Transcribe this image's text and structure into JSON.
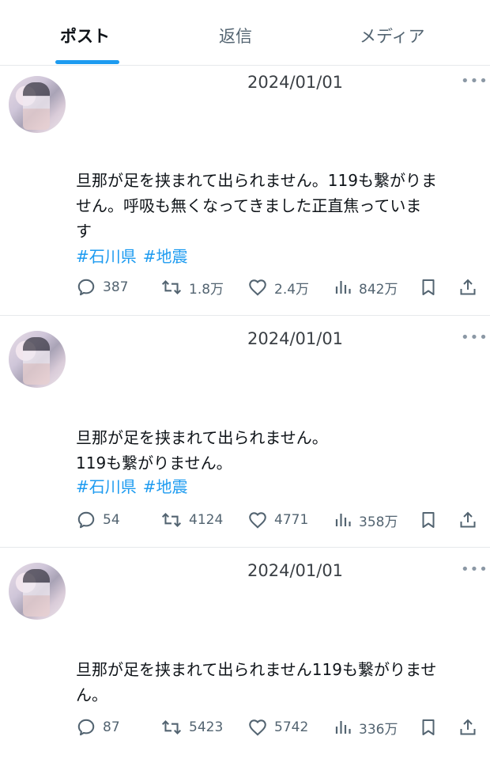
{
  "tabs": [
    {
      "label": "ポスト",
      "active": true
    },
    {
      "label": "返信",
      "active": false
    },
    {
      "label": "メディア",
      "active": false
    }
  ],
  "colors": {
    "accent": "#1d9bf0",
    "text": "#0f1419",
    "muted": "#536471"
  },
  "posts": [
    {
      "date": "2024/01/01",
      "lines": [
        "旦那が足を挟まれて出られません。119も繋がりま",
        "せん。呼吸も無くなってきました正直焦っていま",
        "す"
      ],
      "hashtags": [
        "#石川県",
        "#地震"
      ],
      "replies": "387",
      "reposts": "1.8万",
      "likes": "2.4万",
      "views": "842万"
    },
    {
      "date": "2024/01/01",
      "lines": [
        "旦那が足を挟まれて出られません。",
        "119も繋がりません。"
      ],
      "hashtags": [
        "#石川県",
        "#地震"
      ],
      "replies": "54",
      "reposts": "4124",
      "likes": "4771",
      "views": "358万"
    },
    {
      "date": "2024/01/01",
      "lines": [
        "旦那が足を挟まれて出られません119も繋がりませ",
        "ん。"
      ],
      "hashtags": [],
      "replies": "87",
      "reposts": "5423",
      "likes": "5742",
      "views": "336万"
    }
  ],
  "more_glyph": "•••",
  "icons": [
    "more-icon",
    "reply-icon",
    "repost-icon",
    "like-icon",
    "views-icon",
    "bookmark-icon",
    "share-icon"
  ]
}
